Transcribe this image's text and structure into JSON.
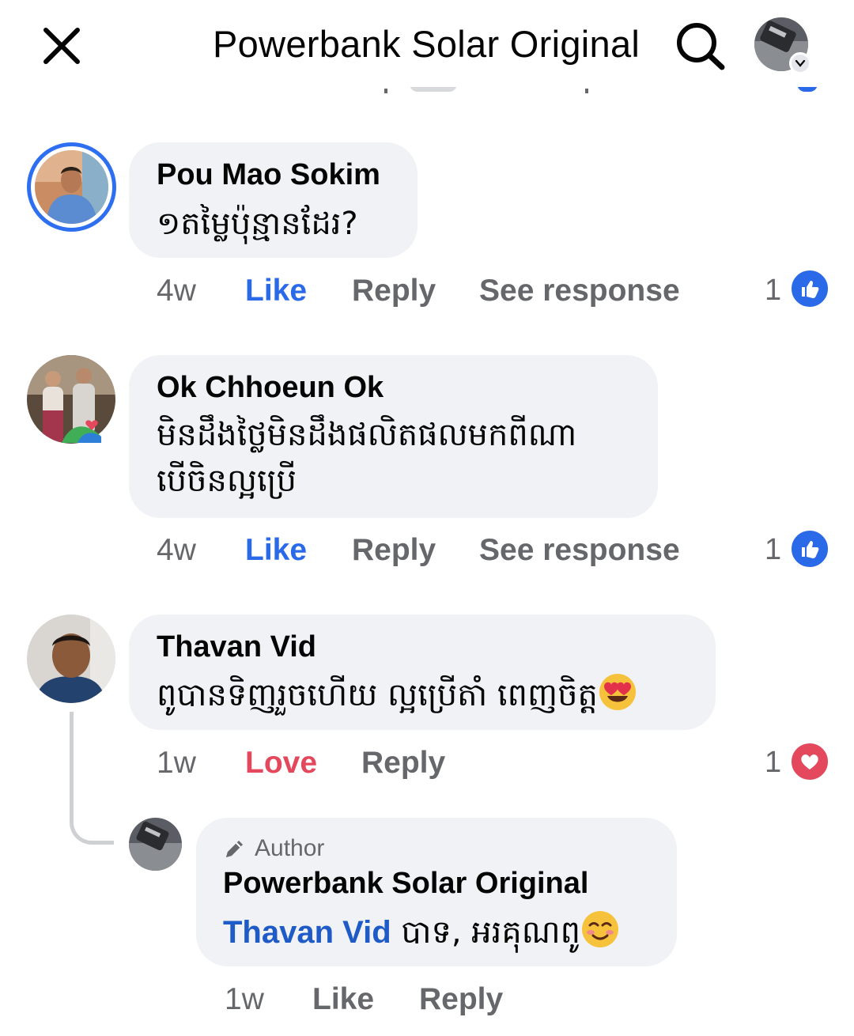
{
  "header": {
    "title": "Powerbank Solar Original",
    "close_icon": "close-icon",
    "search_icon": "search-icon",
    "profile_icon": "profile-menu-avatar"
  },
  "colors": {
    "like_blue": "#2a6ae8",
    "love_red": "#e4485d",
    "bubble_bg": "#f0f2f5",
    "meta_gray": "#65676b"
  },
  "comments": [
    {
      "name": "Pou Mao Sokim",
      "text": [
        "១តម្លៃប៉ុន្មានដែរ?"
      ],
      "time": "4w",
      "reaction_label": "Like",
      "reply_label": "Reply",
      "see_response_label": "See response",
      "reaction_count": "1",
      "reaction_icon": "like-icon"
    },
    {
      "name": "Ok Chhoeun Ok",
      "text": [
        "មិនដឹងថ្លៃមិនដឹងផលិតផលមកពីណា",
        "បើចិនល្អប្រើ"
      ],
      "time": "4w",
      "reaction_label": "Like",
      "reply_label": "Reply",
      "see_response_label": "See response",
      "reaction_count": "1",
      "reaction_icon": "like-icon"
    },
    {
      "name": "Thavan Vid",
      "text": [
        "ពូបានទិញរួចហើយ ល្អប្រើតាំ ពេញចិត្ត"
      ],
      "emoji": "heart-eyes-emoji",
      "time": "1w",
      "reaction_label": "Love",
      "reply_label": "Reply",
      "reaction_count": "1",
      "reaction_icon": "love-icon"
    }
  ],
  "reply": {
    "badge": "Author",
    "badge_icon": "pencil-icon",
    "name": "Powerbank Solar Original",
    "mention": "Thavan Vid",
    "text": " បាទ, អរគុណពូ",
    "emoji": "smiling-blush-emoji",
    "time": "1w",
    "like_label": "Like",
    "reply_label": "Reply"
  }
}
